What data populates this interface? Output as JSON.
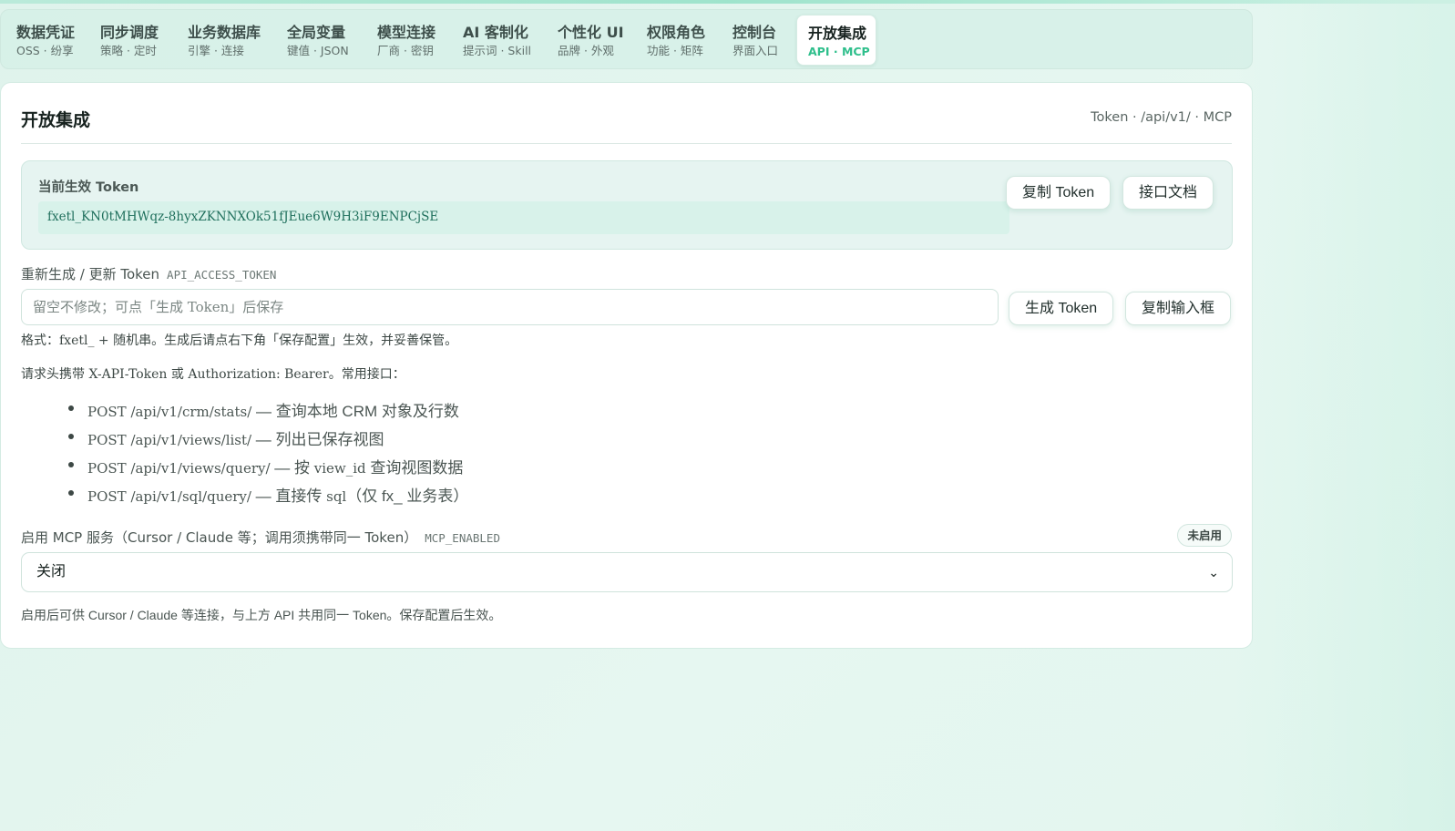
{
  "tabs": [
    {
      "title": "数据凭证",
      "sub": "OSS · 纷享"
    },
    {
      "title": "同步调度",
      "sub": "策略 · 定时"
    },
    {
      "title": "业务数据库",
      "sub": "引擎 · 连接"
    },
    {
      "title": "全局变量",
      "sub": "键值 · JSON"
    },
    {
      "title": "模型连接",
      "sub": "厂商 · 密钥"
    },
    {
      "title": "AI 客制化",
      "sub": "提示词 · Skill"
    },
    {
      "title": "个性化 UI",
      "sub": "品牌 · 外观"
    },
    {
      "title": "权限角色",
      "sub": "功能 · 矩阵"
    },
    {
      "title": "控制台",
      "sub": "界面入口"
    },
    {
      "title": "开放集成",
      "sub": "API · MCP",
      "active": true
    }
  ],
  "panel": {
    "title": "开放集成",
    "meta": "Token · /api/v1/ · MCP"
  },
  "current_token": {
    "label": "当前生效 Token",
    "value": "fxetl_KN0tMHWqz-8hyxZKNNXOk51fJEue6W9H3iF9ENPCjSE",
    "copy_label": "复制 Token",
    "docs_label": "接口文档"
  },
  "regen": {
    "label": "重新生成 / 更新 Token",
    "code": "API_ACCESS_TOKEN",
    "placeholder": "留空不修改；可点「生成 Token」后保存",
    "value": "",
    "generate_label": "生成 Token",
    "copy_input_label": "复制输入框",
    "format_prefix": "格式：",
    "format_code": "fxetl_",
    "format_suffix": " + 随机串。生成后请点右下角「保存配置」生效，并妥善保管。"
  },
  "headers_hint": {
    "prefix": "请求头携带 ",
    "code1": "X-API-Token",
    "mid": " 或 ",
    "code2": "Authorization: Bearer",
    "suffix": "。常用接口："
  },
  "endpoints": [
    {
      "path": "POST /api/v1/crm/stats/",
      "desc_pre": " — 查询本地 CRM 对象及行数",
      "code": "",
      "desc_post": ""
    },
    {
      "path": "POST /api/v1/views/list/",
      "desc_pre": " — 列出已保存视图",
      "code": "",
      "desc_post": ""
    },
    {
      "path": "POST /api/v1/views/query/",
      "desc_pre": " — 按 ",
      "code": "view_id",
      "desc_post": " 查询视图数据"
    },
    {
      "path": "POST /api/v1/sql/query/",
      "desc_pre": " — 直接传 ",
      "code": "sql",
      "desc_post": "（仅 fx_ 业务表）"
    }
  ],
  "mcp": {
    "label": "启用 MCP 服务（Cursor / Claude 等；调用须携带同一 Token）",
    "code": "MCP_ENABLED",
    "status_badge": "未启用",
    "selected": "关闭",
    "hint": "启用后可供 Cursor / Claude 等连接，与上方 API 共用同一 Token。保存配置后生效。"
  },
  "colors": {
    "accent": "#2fbf8c",
    "token_bg": "#d8f2ea",
    "page_bg": "#e3f5ee"
  }
}
